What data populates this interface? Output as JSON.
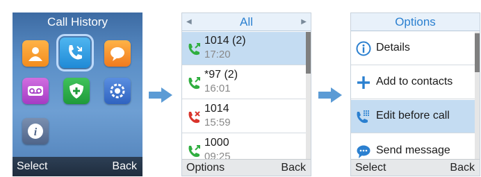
{
  "home": {
    "title": "Call History",
    "softkey_left": "Select",
    "softkey_right": "Back"
  },
  "call_history": {
    "filter": "All",
    "entries": [
      {
        "number": "1014 (2)",
        "time": "17:20",
        "type": "outgoing"
      },
      {
        "number": "*97 (2)",
        "time": "16:01",
        "type": "outgoing"
      },
      {
        "number": "1014",
        "time": "15:59",
        "type": "missed"
      },
      {
        "number": "1000",
        "time": "09:25",
        "type": "outgoing"
      }
    ],
    "softkey_left": "Options",
    "softkey_right": "Back"
  },
  "options": {
    "title": "Options",
    "items": [
      {
        "label": "Details",
        "icon": "info-icon"
      },
      {
        "label": "Add to contacts",
        "icon": "plus-icon"
      },
      {
        "label": "Edit before call",
        "icon": "dialpad-phone-icon"
      },
      {
        "label": "Send message",
        "icon": "message-icon"
      }
    ],
    "softkey_left": "Select",
    "softkey_right": "Back"
  },
  "colors": {
    "accent": "#2b80d0",
    "selection": "#c4dcf2",
    "outgoing_call": "#2fae3f",
    "missed_call": "#d9342b",
    "flow_arrow": "#5b9bd5"
  }
}
